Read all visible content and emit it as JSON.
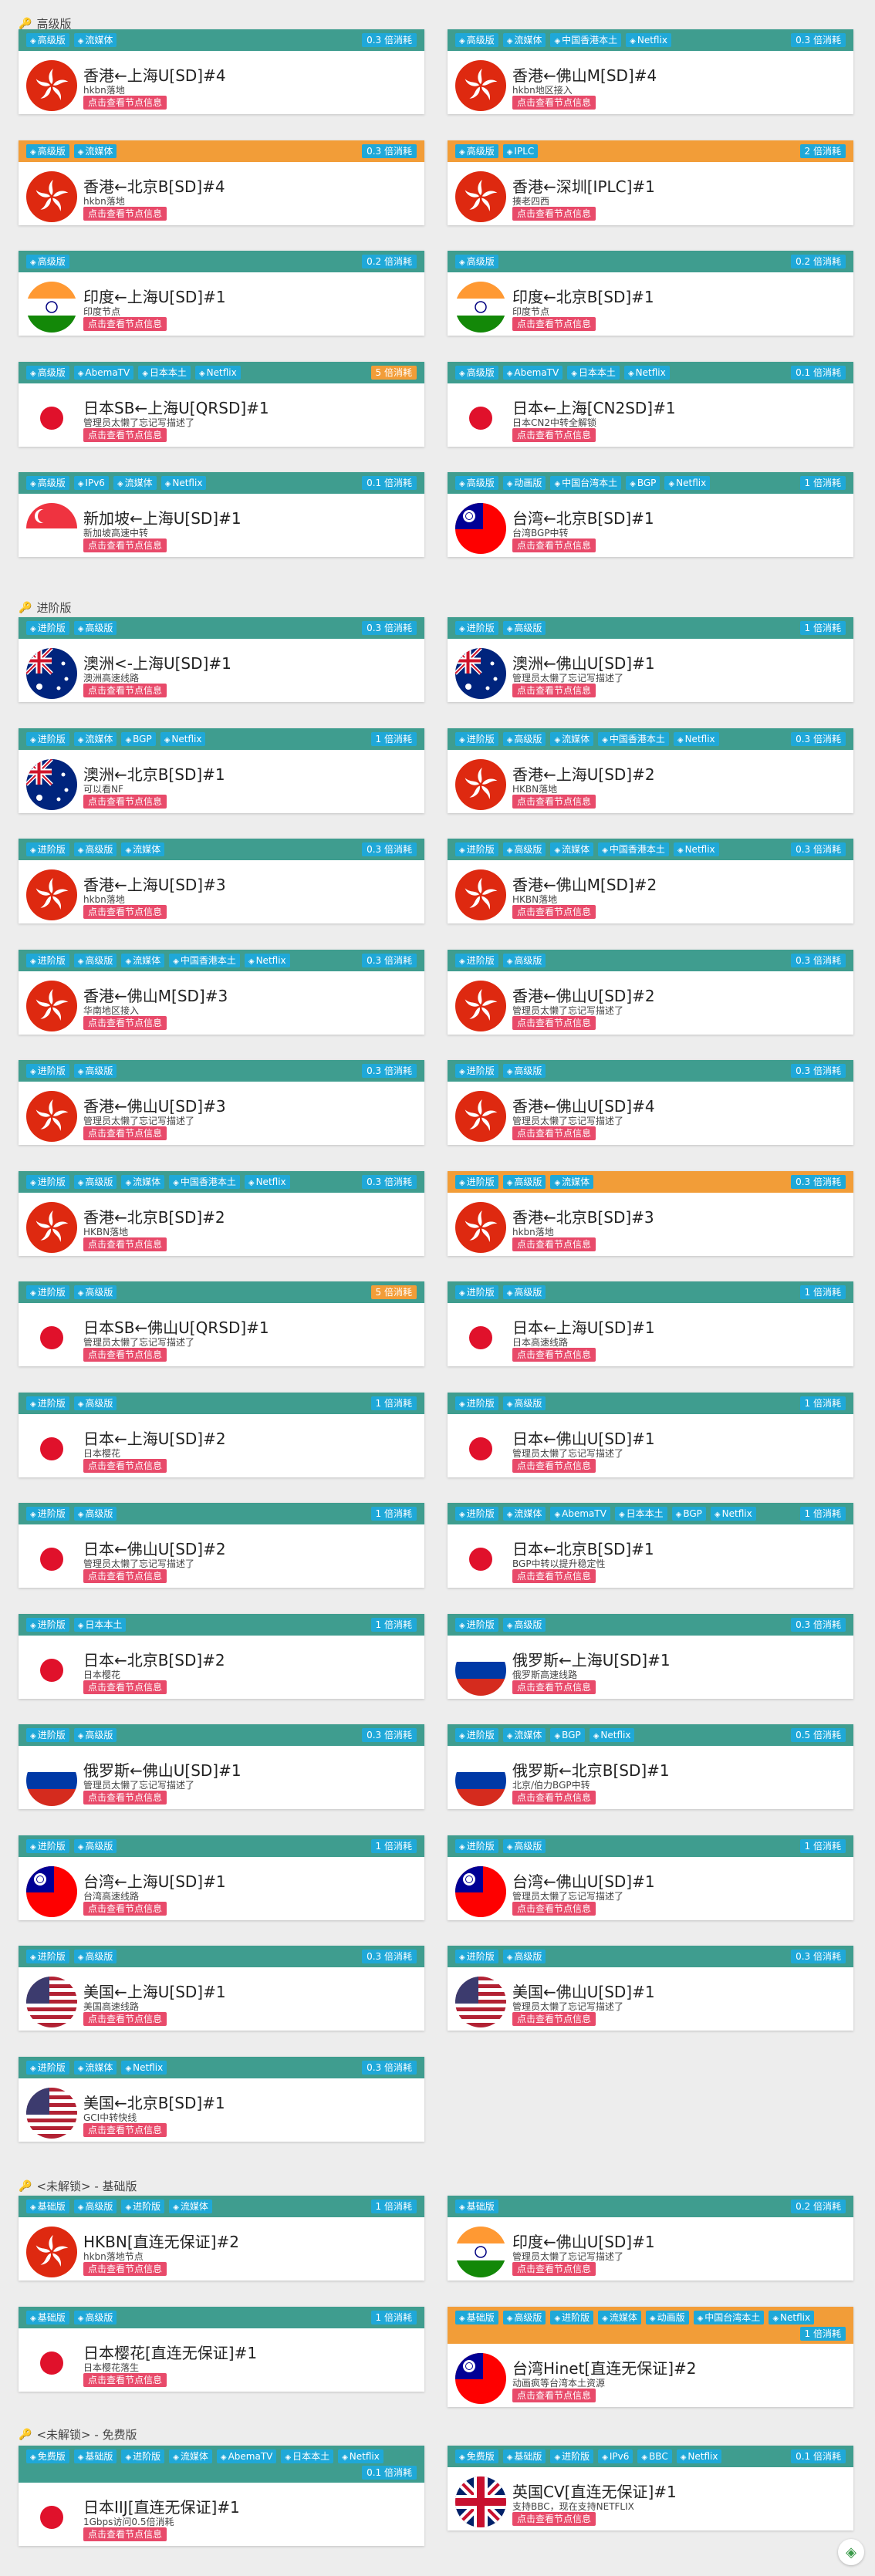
{
  "tags": {
    "advanced": "高级版",
    "pro": "进阶版",
    "basic": "基础版",
    "free": "免费版",
    "stream": "流媒体",
    "cnhk": "中国香港本土",
    "netflix": "Netflix",
    "iplc": "IPLC",
    "abema": "AbemaTV",
    "jp": "日本本土",
    "ipv6": "IPv6",
    "anime": "动画版",
    "tw": "中国台湾本土",
    "bgp": "BGP",
    "bbc": "BBC"
  },
  "btn_label": "点击查看节点信息",
  "sections": [
    {
      "title": "高级版",
      "cards": [
        {
          "tags": [
            "advanced",
            "stream"
          ],
          "rate": "0.3 倍消耗",
          "flag": "hk",
          "title": "香港←上海U[SD]#4",
          "desc": "hkbn落地"
        },
        {
          "tags": [
            "advanced",
            "stream",
            "cnhk",
            "netflix"
          ],
          "rate": "0.3 倍消耗",
          "flag": "hk",
          "title": "香港←佛山M[SD]#4",
          "desc": "hkbn地区接入"
        },
        {
          "tags": [
            "advanced",
            "stream"
          ],
          "rate": "0.3 倍消耗",
          "flag": "hk",
          "title": "香港←北京B[SD]#4",
          "desc": "hkbn落地",
          "orange": true
        },
        {
          "tags": [
            "advanced",
            "iplc"
          ],
          "rate": "2 倍消耗",
          "flag": "hk",
          "title": "香港←深圳[IPLC]#1",
          "desc": "揍老四西",
          "orange": true
        },
        {
          "tags": [
            "advanced"
          ],
          "rate": "0.2 倍消耗",
          "flag": "in",
          "title": "印度←上海U[SD]#1",
          "desc": "印度节点"
        },
        {
          "tags": [
            "advanced"
          ],
          "rate": "0.2 倍消耗",
          "flag": "in",
          "title": "印度←北京B[SD]#1",
          "desc": "印度节点"
        },
        {
          "tags": [
            "advanced",
            "abema",
            "jp",
            "netflix"
          ],
          "rate": "5 倍消耗",
          "flag": "jp",
          "title": "日本SB←上海U[QRSD]#1",
          "desc": "管理员太懒了忘记写描述了",
          "rateOrange": true
        },
        {
          "tags": [
            "advanced",
            "abema",
            "jp",
            "netflix"
          ],
          "rate": "0.1 倍消耗",
          "flag": "jp",
          "title": "日本←上海[CN2SD]#1",
          "desc": "日本CN2中转全解锁"
        },
        {
          "tags": [
            "advanced",
            "ipv6",
            "stream",
            "netflix"
          ],
          "rate": "0.1 倍消耗",
          "flag": "sg",
          "title": "新加坡←上海U[SD]#1",
          "desc": "新加坡高速中转"
        },
        {
          "tags": [
            "advanced",
            "anime",
            "tw",
            "bgp",
            "netflix"
          ],
          "rate": "1 倍消耗",
          "flag": "tw",
          "title": "台湾←北京B[SD]#1",
          "desc": "台湾BGP中转"
        }
      ]
    },
    {
      "title": "进阶版",
      "cards": [
        {
          "tags": [
            "pro",
            "advanced"
          ],
          "rate": "0.3 倍消耗",
          "flag": "au",
          "title": "澳洲<-上海U[SD]#1",
          "desc": "澳洲高速线路"
        },
        {
          "tags": [
            "pro",
            "advanced"
          ],
          "rate": "1 倍消耗",
          "flag": "au",
          "title": "澳洲←佛山U[SD]#1",
          "desc": "管理员太懒了忘记写描述了"
        },
        {
          "tags": [
            "pro",
            "stream",
            "bgp",
            "netflix"
          ],
          "rate": "1 倍消耗",
          "flag": "au",
          "title": "澳洲←北京B[SD]#1",
          "desc": "可以看NF"
        },
        {
          "tags": [
            "pro",
            "advanced",
            "stream",
            "cnhk",
            "netflix"
          ],
          "rate": "0.3 倍消耗",
          "flag": "hk",
          "title": "香港←上海U[SD]#2",
          "desc": "HKBN落地"
        },
        {
          "tags": [
            "pro",
            "advanced",
            "stream"
          ],
          "rate": "0.3 倍消耗",
          "flag": "hk",
          "title": "香港←上海U[SD]#3",
          "desc": "hkbn落地"
        },
        {
          "tags": [
            "pro",
            "advanced",
            "stream",
            "cnhk",
            "netflix"
          ],
          "rate": "0.3 倍消耗",
          "flag": "hk",
          "title": "香港←佛山M[SD]#2",
          "desc": "HKBN落地"
        },
        {
          "tags": [
            "pro",
            "advanced",
            "stream",
            "cnhk",
            "netflix"
          ],
          "rate": "0.3 倍消耗",
          "flag": "hk",
          "title": "香港←佛山M[SD]#3",
          "desc": "华南地区接入"
        },
        {
          "tags": [
            "pro",
            "advanced"
          ],
          "rate": "0.3 倍消耗",
          "flag": "hk",
          "title": "香港←佛山U[SD]#2",
          "desc": "管理员太懒了忘记写描述了"
        },
        {
          "tags": [
            "pro",
            "advanced"
          ],
          "rate": "0.3 倍消耗",
          "flag": "hk",
          "title": "香港←佛山U[SD]#3",
          "desc": "管理员太懒了忘记写描述了"
        },
        {
          "tags": [
            "pro",
            "advanced"
          ],
          "rate": "0.3 倍消耗",
          "flag": "hk",
          "title": "香港←佛山U[SD]#4",
          "desc": "管理员太懒了忘记写描述了"
        },
        {
          "tags": [
            "pro",
            "advanced",
            "stream",
            "cnhk",
            "netflix"
          ],
          "rate": "0.3 倍消耗",
          "flag": "hk",
          "title": "香港←北京B[SD]#2",
          "desc": "HKBN落地"
        },
        {
          "tags": [
            "pro",
            "advanced",
            "stream"
          ],
          "rate": "0.3 倍消耗",
          "flag": "hk",
          "title": "香港←北京B[SD]#3",
          "desc": "hkbn落地",
          "orange": true
        },
        {
          "tags": [
            "pro",
            "advanced"
          ],
          "rate": "5 倍消耗",
          "flag": "jp",
          "title": "日本SB←佛山U[QRSD]#1",
          "desc": "管理员太懒了忘记写描述了",
          "rateOrange": true
        },
        {
          "tags": [
            "pro",
            "advanced"
          ],
          "rate": "1 倍消耗",
          "flag": "jp",
          "title": "日本←上海U[SD]#1",
          "desc": "日本高速线路"
        },
        {
          "tags": [
            "pro",
            "advanced"
          ],
          "rate": "1 倍消耗",
          "flag": "jp",
          "title": "日本←上海U[SD]#2",
          "desc": "日本樱花"
        },
        {
          "tags": [
            "pro",
            "advanced"
          ],
          "rate": "1 倍消耗",
          "flag": "jp",
          "title": "日本←佛山U[SD]#1",
          "desc": "管理员太懒了忘记写描述了"
        },
        {
          "tags": [
            "pro",
            "advanced"
          ],
          "rate": "1 倍消耗",
          "flag": "jp",
          "title": "日本←佛山U[SD]#2",
          "desc": "管理员太懒了忘记写描述了"
        },
        {
          "tags": [
            "pro",
            "stream",
            "abema",
            "jp",
            "bgp",
            "netflix"
          ],
          "rate": "1 倍消耗",
          "flag": "jp",
          "title": "日本←北京B[SD]#1",
          "desc": "BGP中转以提升稳定性"
        },
        {
          "tags": [
            "pro",
            "jp"
          ],
          "rate": "1 倍消耗",
          "flag": "jp",
          "title": "日本←北京B[SD]#2",
          "desc": "日本樱花"
        },
        {
          "tags": [
            "pro",
            "advanced"
          ],
          "rate": "0.3 倍消耗",
          "flag": "ru",
          "title": "俄罗斯←上海U[SD]#1",
          "desc": "俄罗斯高速线路"
        },
        {
          "tags": [
            "pro",
            "advanced"
          ],
          "rate": "0.3 倍消耗",
          "flag": "ru",
          "title": "俄罗斯←佛山U[SD]#1",
          "desc": "管理员太懒了忘记写描述了"
        },
        {
          "tags": [
            "pro",
            "stream",
            "bgp",
            "netflix"
          ],
          "rate": "0.5 倍消耗",
          "flag": "ru",
          "title": "俄罗斯←北京B[SD]#1",
          "desc": "北京/伯力BGP中转"
        },
        {
          "tags": [
            "pro",
            "advanced"
          ],
          "rate": "1 倍消耗",
          "flag": "tw",
          "title": "台湾←上海U[SD]#1",
          "desc": "台湾高速线路"
        },
        {
          "tags": [
            "pro",
            "advanced"
          ],
          "rate": "1 倍消耗",
          "flag": "tw",
          "title": "台湾←佛山U[SD]#1",
          "desc": "管理员太懒了忘记写描述了"
        },
        {
          "tags": [
            "pro",
            "advanced"
          ],
          "rate": "0.3 倍消耗",
          "flag": "us",
          "title": "美国←上海U[SD]#1",
          "desc": "美国高速线路"
        },
        {
          "tags": [
            "pro",
            "advanced"
          ],
          "rate": "0.3 倍消耗",
          "flag": "us",
          "title": "美国←佛山U[SD]#1",
          "desc": "管理员太懒了忘记写描述了"
        },
        {
          "tags": [
            "pro",
            "stream",
            "netflix"
          ],
          "rate": "0.3 倍消耗",
          "flag": "us",
          "title": "美国←北京B[SD]#1",
          "desc": "GCI中转快线"
        }
      ]
    },
    {
      "title": "<未解锁> - 基础版",
      "cards": [
        {
          "tags": [
            "basic",
            "advanced",
            "pro",
            "stream"
          ],
          "rate": "1 倍消耗",
          "flag": "hk",
          "title": "HKBN[直连无保证]#2",
          "desc": "hkbn落地节点"
        },
        {
          "tags": [
            "basic"
          ],
          "rate": "0.2 倍消耗",
          "flag": "in",
          "title": "印度←佛山U[SD]#1",
          "desc": "管理员太懒了忘记写描述了"
        },
        {
          "tags": [
            "basic",
            "advanced"
          ],
          "rate": "1 倍消耗",
          "flag": "jp",
          "title": "日本樱花[直连无保证]#1",
          "desc": "日本樱花落生"
        },
        {
          "tags": [
            "basic",
            "advanced",
            "pro",
            "stream",
            "anime",
            "tw",
            "netflix"
          ],
          "rate": "1 倍消耗",
          "flag": "tw",
          "title": "台湾Hinet[直连无保证]#2",
          "desc": "动画疯等台湾本土资源",
          "orange": true,
          "tall": true
        }
      ]
    },
    {
      "title": "<未解锁> - 免费版",
      "cards": [
        {
          "tags": [
            "free",
            "basic",
            "pro",
            "stream",
            "abema",
            "jp",
            "netflix"
          ],
          "rate": "0.1 倍消耗",
          "flag": "jp",
          "title": "日本IIJ[直连无保证]#1",
          "desc": "1Gbps访问0.5倍消耗",
          "tall": true
        },
        {
          "tags": [
            "free",
            "basic",
            "pro",
            "ipv6",
            "bbc",
            "netflix"
          ],
          "rate": "0.1 倍消耗",
          "flag": "gb",
          "title": "英国CV[直连无保证]#1",
          "desc": "支持BBC，现在支持NETFLIX"
        }
      ]
    }
  ]
}
